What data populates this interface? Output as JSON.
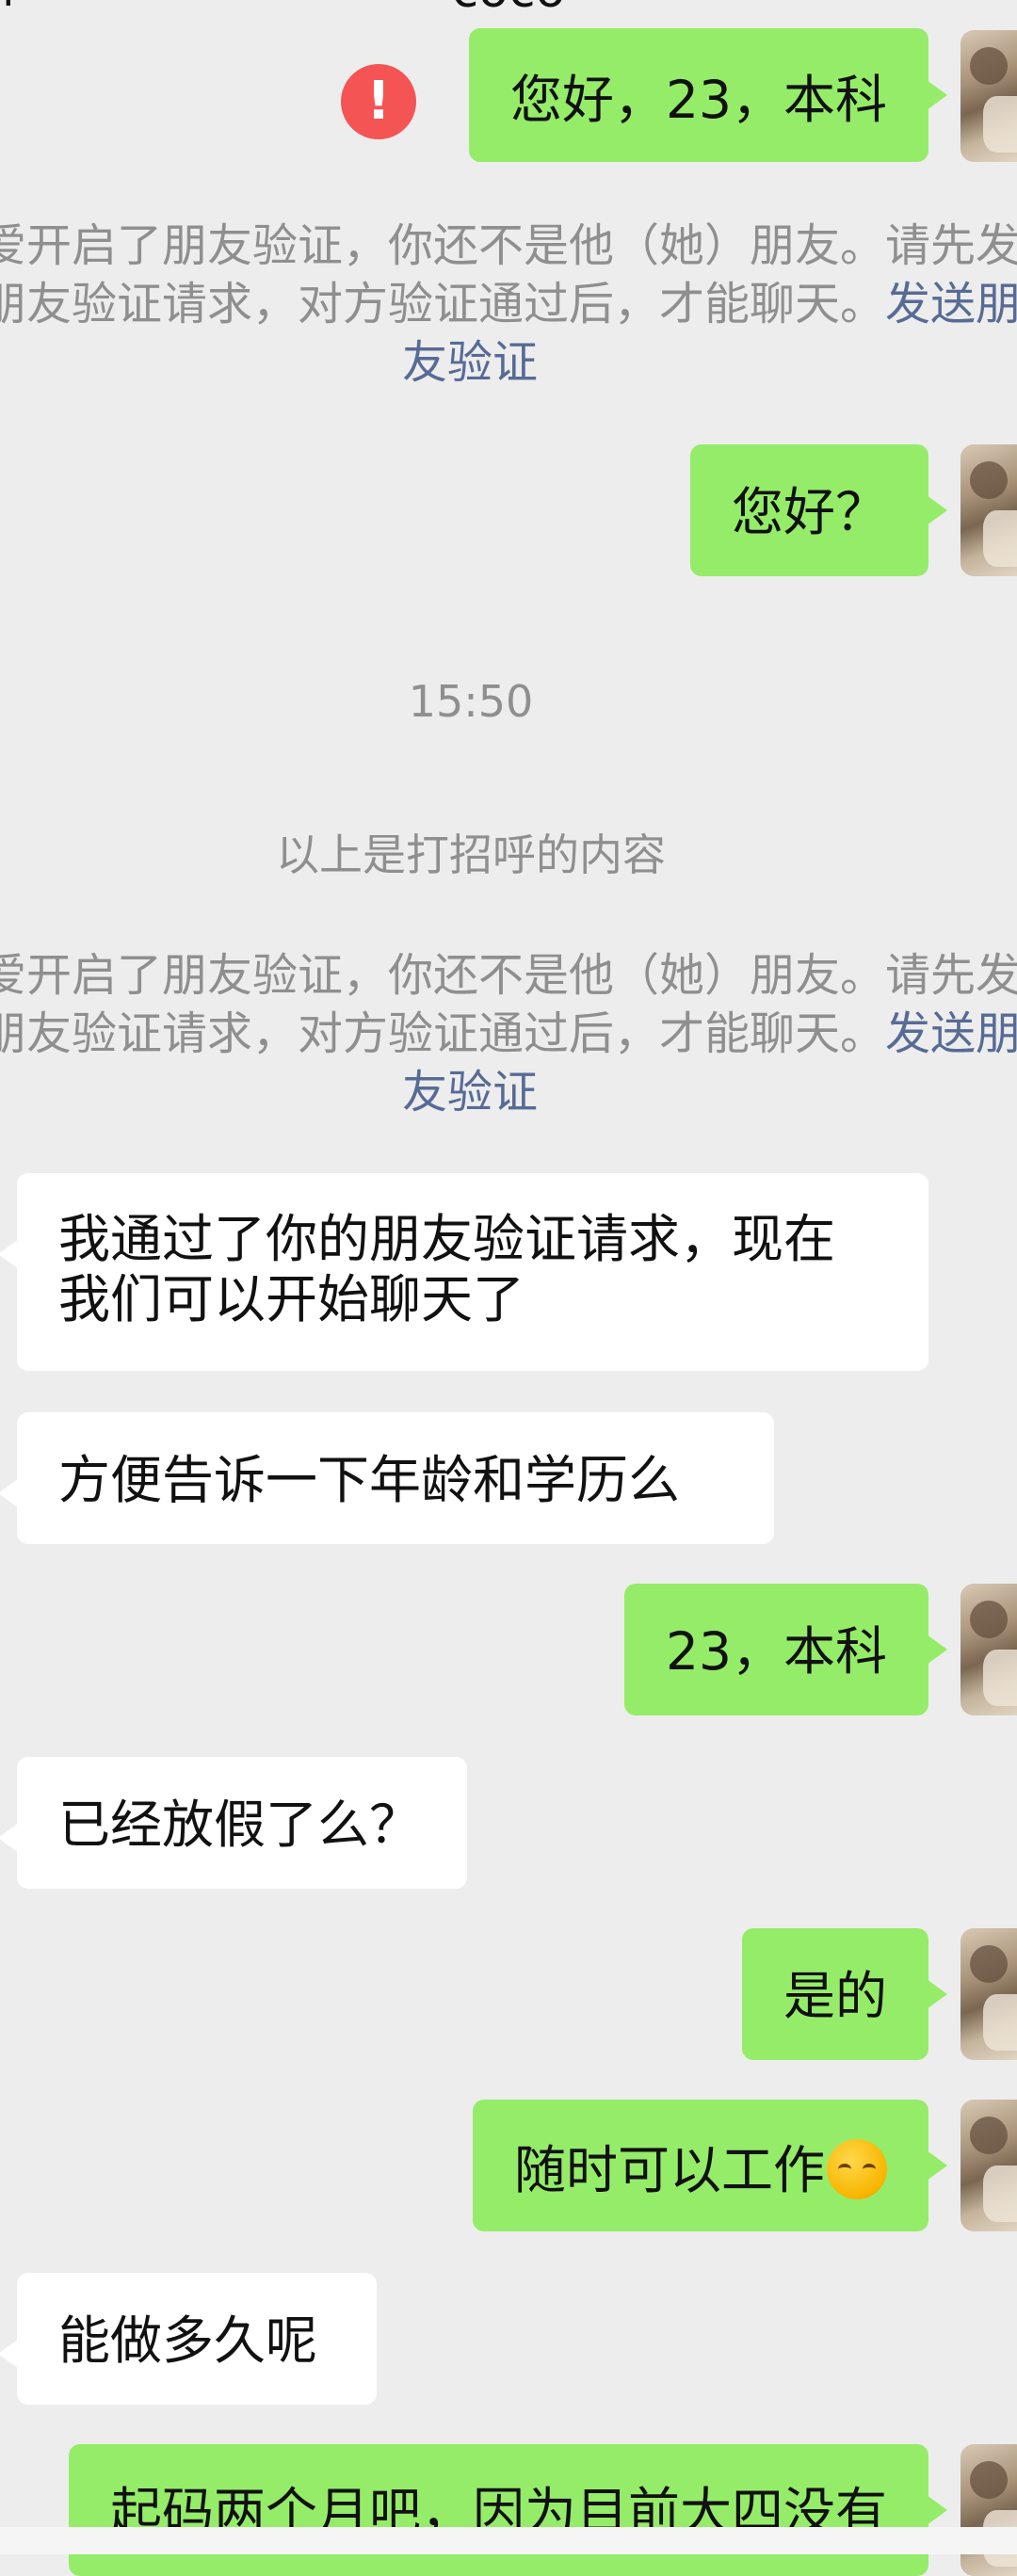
{
  "header": {
    "title": "coco",
    "left_fragment": "4"
  },
  "chat": {
    "msg1": {
      "text": "您好，23，本科",
      "status": "send-failed"
    },
    "sys1": {
      "line1": "爱开启了朋友验证，你还不是他（她）朋友。请先发",
      "line2_prefix": "朋友验证请求，对方验证通过后，才能聊天。",
      "line2_link": "发送朋",
      "line3": "友验证"
    },
    "msg2": {
      "text": "您好？"
    },
    "timestamp": "15:50",
    "greeting_notice": "以上是打招呼的内容",
    "sys2": {
      "line1": "爱开启了朋友验证，你还不是他（她）朋友。请先发",
      "line2_prefix": "朋友验证请求，对方验证通过后，才能聊天。",
      "line2_link": "发送朋",
      "line3": "友验证"
    },
    "msg3": {
      "line1": "我通过了你的朋友验证请求，现在",
      "line2": "我们可以开始聊天了"
    },
    "msg4": {
      "text": "方便告诉一下年龄和学历么"
    },
    "msg5": {
      "text": "23，本科"
    },
    "msg6": {
      "text": "已经放假了么？"
    },
    "msg7": {
      "text": "是的"
    },
    "msg8": {
      "text": "随时可以工作",
      "emoji": "grinning-squint-emoji"
    },
    "msg9": {
      "text": "能做多久呢"
    },
    "msg10": {
      "text": "起码两个月吧，因为目前大四没有"
    }
  }
}
